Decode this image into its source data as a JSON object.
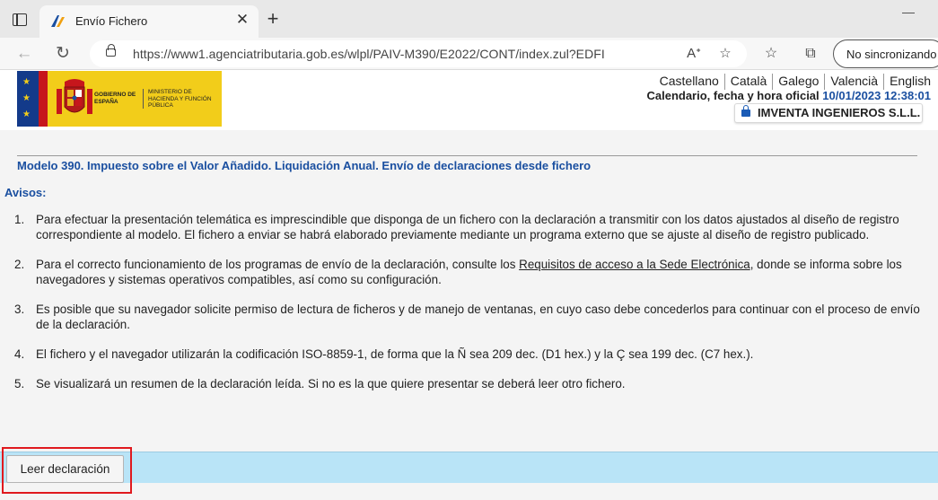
{
  "browser": {
    "tab_title": "Envío Fichero",
    "tab_close": "✕",
    "new_tab": "+",
    "url": "https://www1.agenciatributaria.gob.es/wlpl/PAIV-M390/E2022/CONT/index.zul?EDFI",
    "profile_label": "No sincronizando",
    "icons": {
      "back": "back-arrow-icon",
      "reload": "reload-icon",
      "lock": "lock-icon",
      "read_aloud": "read-aloud-icon",
      "add_favorite": "add-favorite-icon",
      "favorites": "favorites-icon",
      "collections": "collections-icon"
    }
  },
  "header": {
    "logo_text_1": "GOBIERNO DE ESPAÑA",
    "logo_text_2": "MINISTERIO DE HACIENDA Y FUNCIÓN PÚBLICA",
    "languages": [
      "Castellano",
      "Català",
      "Galego",
      "Valencià",
      "English"
    ],
    "calendar_label": "Calendario, fecha y hora oficial",
    "calendar_value": "10/01/2023 12:38:01",
    "company": "IMVENTA INGENIEROS S.L.L."
  },
  "content": {
    "model_title": "Modelo 390. Impuesto sobre el Valor Añadido. Liquidación Anual. Envío de declaraciones desde fichero",
    "avisos_heading": "Avisos:",
    "notices": [
      {
        "number": "1.",
        "text": "Para efectuar la presentación telemática es imprescindible que disponga de un fichero con la declaración a transmitir con los datos ajustados al diseño de registro correspondiente al modelo. El fichero a enviar se habrá elaborado previamente mediante un programa externo que se ajuste al diseño de registro publicado."
      },
      {
        "number": "2.",
        "text_before": "Para el correcto funcionamiento de los programas de envío de la declaración, consulte los ",
        "link": "Requisitos de acceso a la Sede Electrónica",
        "text_after": ", donde se informa sobre los navegadores y sistemas operativos compatibles, así como su configuración."
      },
      {
        "number": "3.",
        "text": "Es posible que su navegador solicite permiso de lectura de ficheros y de manejo de ventanas, en cuyo caso debe concederlos para continuar con el proceso de envío de la declaración."
      },
      {
        "number": "4.",
        "text": "El fichero y el navegador utilizarán la codificación ISO-8859-1, de forma que la Ñ sea 209 dec. (D1 hex.) y la Ç sea 199 dec. (C7 hex.)."
      },
      {
        "number": "5.",
        "text": "Se visualizará un resumen de la declaración leída. Si no es la que quiere presentar se deberá leer otro fichero."
      }
    ],
    "read_button": "Leer declaración"
  },
  "colors": {
    "accent_blue": "#1a4fa0",
    "action_bar": "#b9e4f7",
    "highlight": "#e0191e",
    "logo_yellow": "#f2cd1a"
  }
}
